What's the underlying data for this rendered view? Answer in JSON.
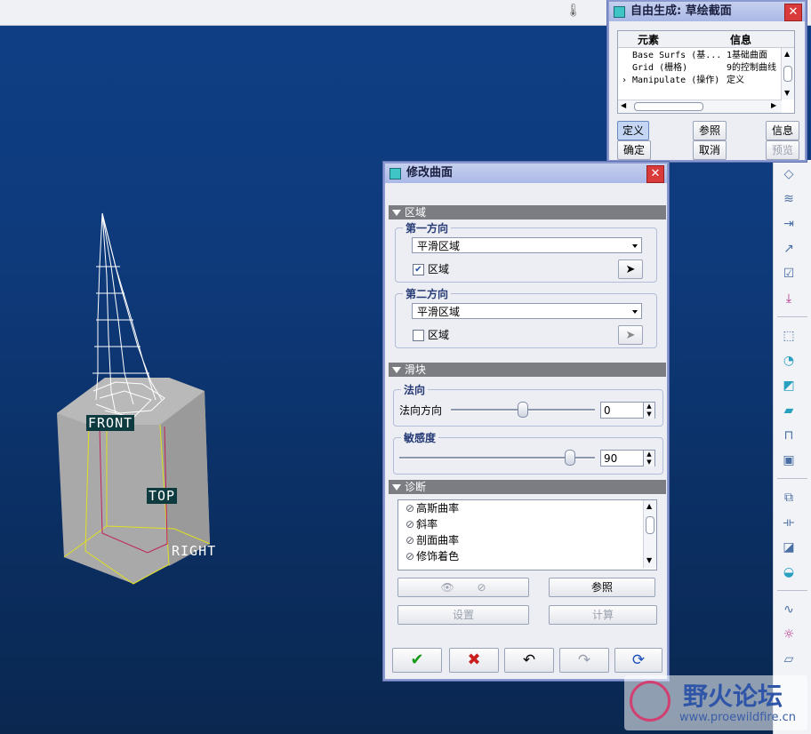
{
  "viewport": {
    "labels": {
      "front": "FRONT",
      "top": "TOP",
      "right": "RIGHT"
    }
  },
  "tool_dialog": {
    "title": "自由生成: 草绘截面",
    "table": {
      "headers": [
        "元素",
        "信息"
      ],
      "rows": [
        {
          "element": "Base Surfs (基...",
          "info": "1基础曲面"
        },
        {
          "element": "Grid (栅格)",
          "info": "9的控制曲线"
        },
        {
          "element": "Manipulate (操作)",
          "info": "定义",
          "current": true
        }
      ]
    },
    "buttons": {
      "define": "定义",
      "refs": "参照",
      "info": "信息",
      "ok": "确定",
      "cancel": "取消",
      "preview": "预览"
    }
  },
  "modify_dialog": {
    "title": "修改曲面",
    "region_section": "区域",
    "dir1": {
      "title": "第一方向",
      "select_value": "平滑区域",
      "checkbox_label": "区域",
      "checked": true
    },
    "dir2": {
      "title": "第二方向",
      "select_value": "平滑区域",
      "checkbox_label": "区域",
      "checked": false
    },
    "slider_section": "滑块",
    "normal": {
      "title": "法向",
      "label": "法向方向",
      "value": "0",
      "level": 0.5
    },
    "sensitivity": {
      "title": "敏感度",
      "value": "90",
      "level": 0.9
    },
    "diagnostics_section": "诊断",
    "diagnostics": [
      "高斯曲率",
      "斜率",
      "剖面曲率",
      "修饰着色"
    ],
    "buttons": {
      "eye_show": "👁",
      "eye_hide": "⊘",
      "refs": "参照",
      "settings": "设置",
      "compute": "计算"
    },
    "icons": [
      "ok-check-icon",
      "cancel-x-icon",
      "undo-icon",
      "redo-icon",
      "regenerate-icon"
    ]
  },
  "watermark": {
    "text": "野火论坛",
    "url": "www.proewildfire.cn"
  },
  "colors": {
    "ok": "#1a9a1a",
    "cancel": "#c81e1e",
    "section": "#7b7d82",
    "viewport": "#0e3a7b"
  }
}
